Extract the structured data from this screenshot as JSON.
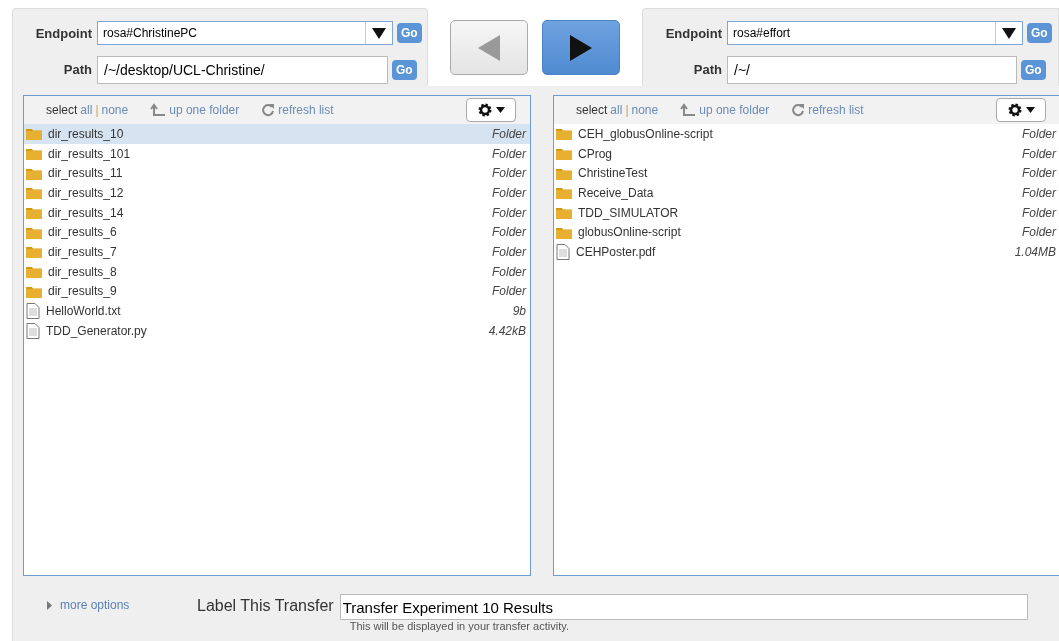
{
  "panes": [
    {
      "endpoint_label": "Endpoint",
      "endpoint": "rosa#ChristinePC",
      "endpoint_go": "Go",
      "path_label": "Path",
      "path": "/~/desktop/UCL-Christine/",
      "path_go": "Go",
      "toolbar": {
        "select": "select",
        "all": "all",
        "separator": "|",
        "none": "none",
        "up": "up one folder",
        "refresh": "refresh list"
      },
      "files": [
        {
          "kind": "folder",
          "name": "dir_results_10",
          "size": "Folder",
          "selected": true
        },
        {
          "kind": "folder",
          "name": "dir_results_101",
          "size": "Folder",
          "selected": false
        },
        {
          "kind": "folder",
          "name": "dir_results_11",
          "size": "Folder",
          "selected": false
        },
        {
          "kind": "folder",
          "name": "dir_results_12",
          "size": "Folder",
          "selected": false
        },
        {
          "kind": "folder",
          "name": "dir_results_14",
          "size": "Folder",
          "selected": false
        },
        {
          "kind": "folder",
          "name": "dir_results_6",
          "size": "Folder",
          "selected": false
        },
        {
          "kind": "folder",
          "name": "dir_results_7",
          "size": "Folder",
          "selected": false
        },
        {
          "kind": "folder",
          "name": "dir_results_8",
          "size": "Folder",
          "selected": false
        },
        {
          "kind": "folder",
          "name": "dir_results_9",
          "size": "Folder",
          "selected": false
        },
        {
          "kind": "file",
          "name": "HelloWorld.txt",
          "size": "9b",
          "selected": false
        },
        {
          "kind": "file",
          "name": "TDD_Generator.py",
          "size": "4.42kB",
          "selected": false
        }
      ]
    },
    {
      "endpoint_label": "Endpoint",
      "endpoint": "rosa#effort",
      "endpoint_go": "Go",
      "path_label": "Path",
      "path": "/~/",
      "path_go": "Go",
      "toolbar": {
        "select": "select",
        "all": "all",
        "separator": "|",
        "none": "none",
        "up": "up one folder",
        "refresh": "refresh list"
      },
      "files": [
        {
          "kind": "folder",
          "name": "CEH_globusOnline-script",
          "size": "Folder",
          "selected": false
        },
        {
          "kind": "folder",
          "name": "CProg",
          "size": "Folder",
          "selected": false
        },
        {
          "kind": "folder",
          "name": "ChristineTest",
          "size": "Folder",
          "selected": false
        },
        {
          "kind": "folder",
          "name": "Receive_Data",
          "size": "Folder",
          "selected": false
        },
        {
          "kind": "folder",
          "name": "TDD_SIMULATOR",
          "size": "Folder",
          "selected": false
        },
        {
          "kind": "folder",
          "name": "globusOnline-script",
          "size": "Folder",
          "selected": false
        },
        {
          "kind": "file",
          "name": "CEHPoster.pdf",
          "size": "1.04MB",
          "selected": false
        }
      ]
    }
  ],
  "directions": [
    {
      "kind": "left",
      "selected": false
    },
    {
      "kind": "right",
      "selected": true
    }
  ],
  "options": {
    "more_options": "more options",
    "label": "Label This Transfer",
    "value": "Transfer Experiment 10 Results",
    "hint": "This will be displayed in your transfer activity."
  }
}
